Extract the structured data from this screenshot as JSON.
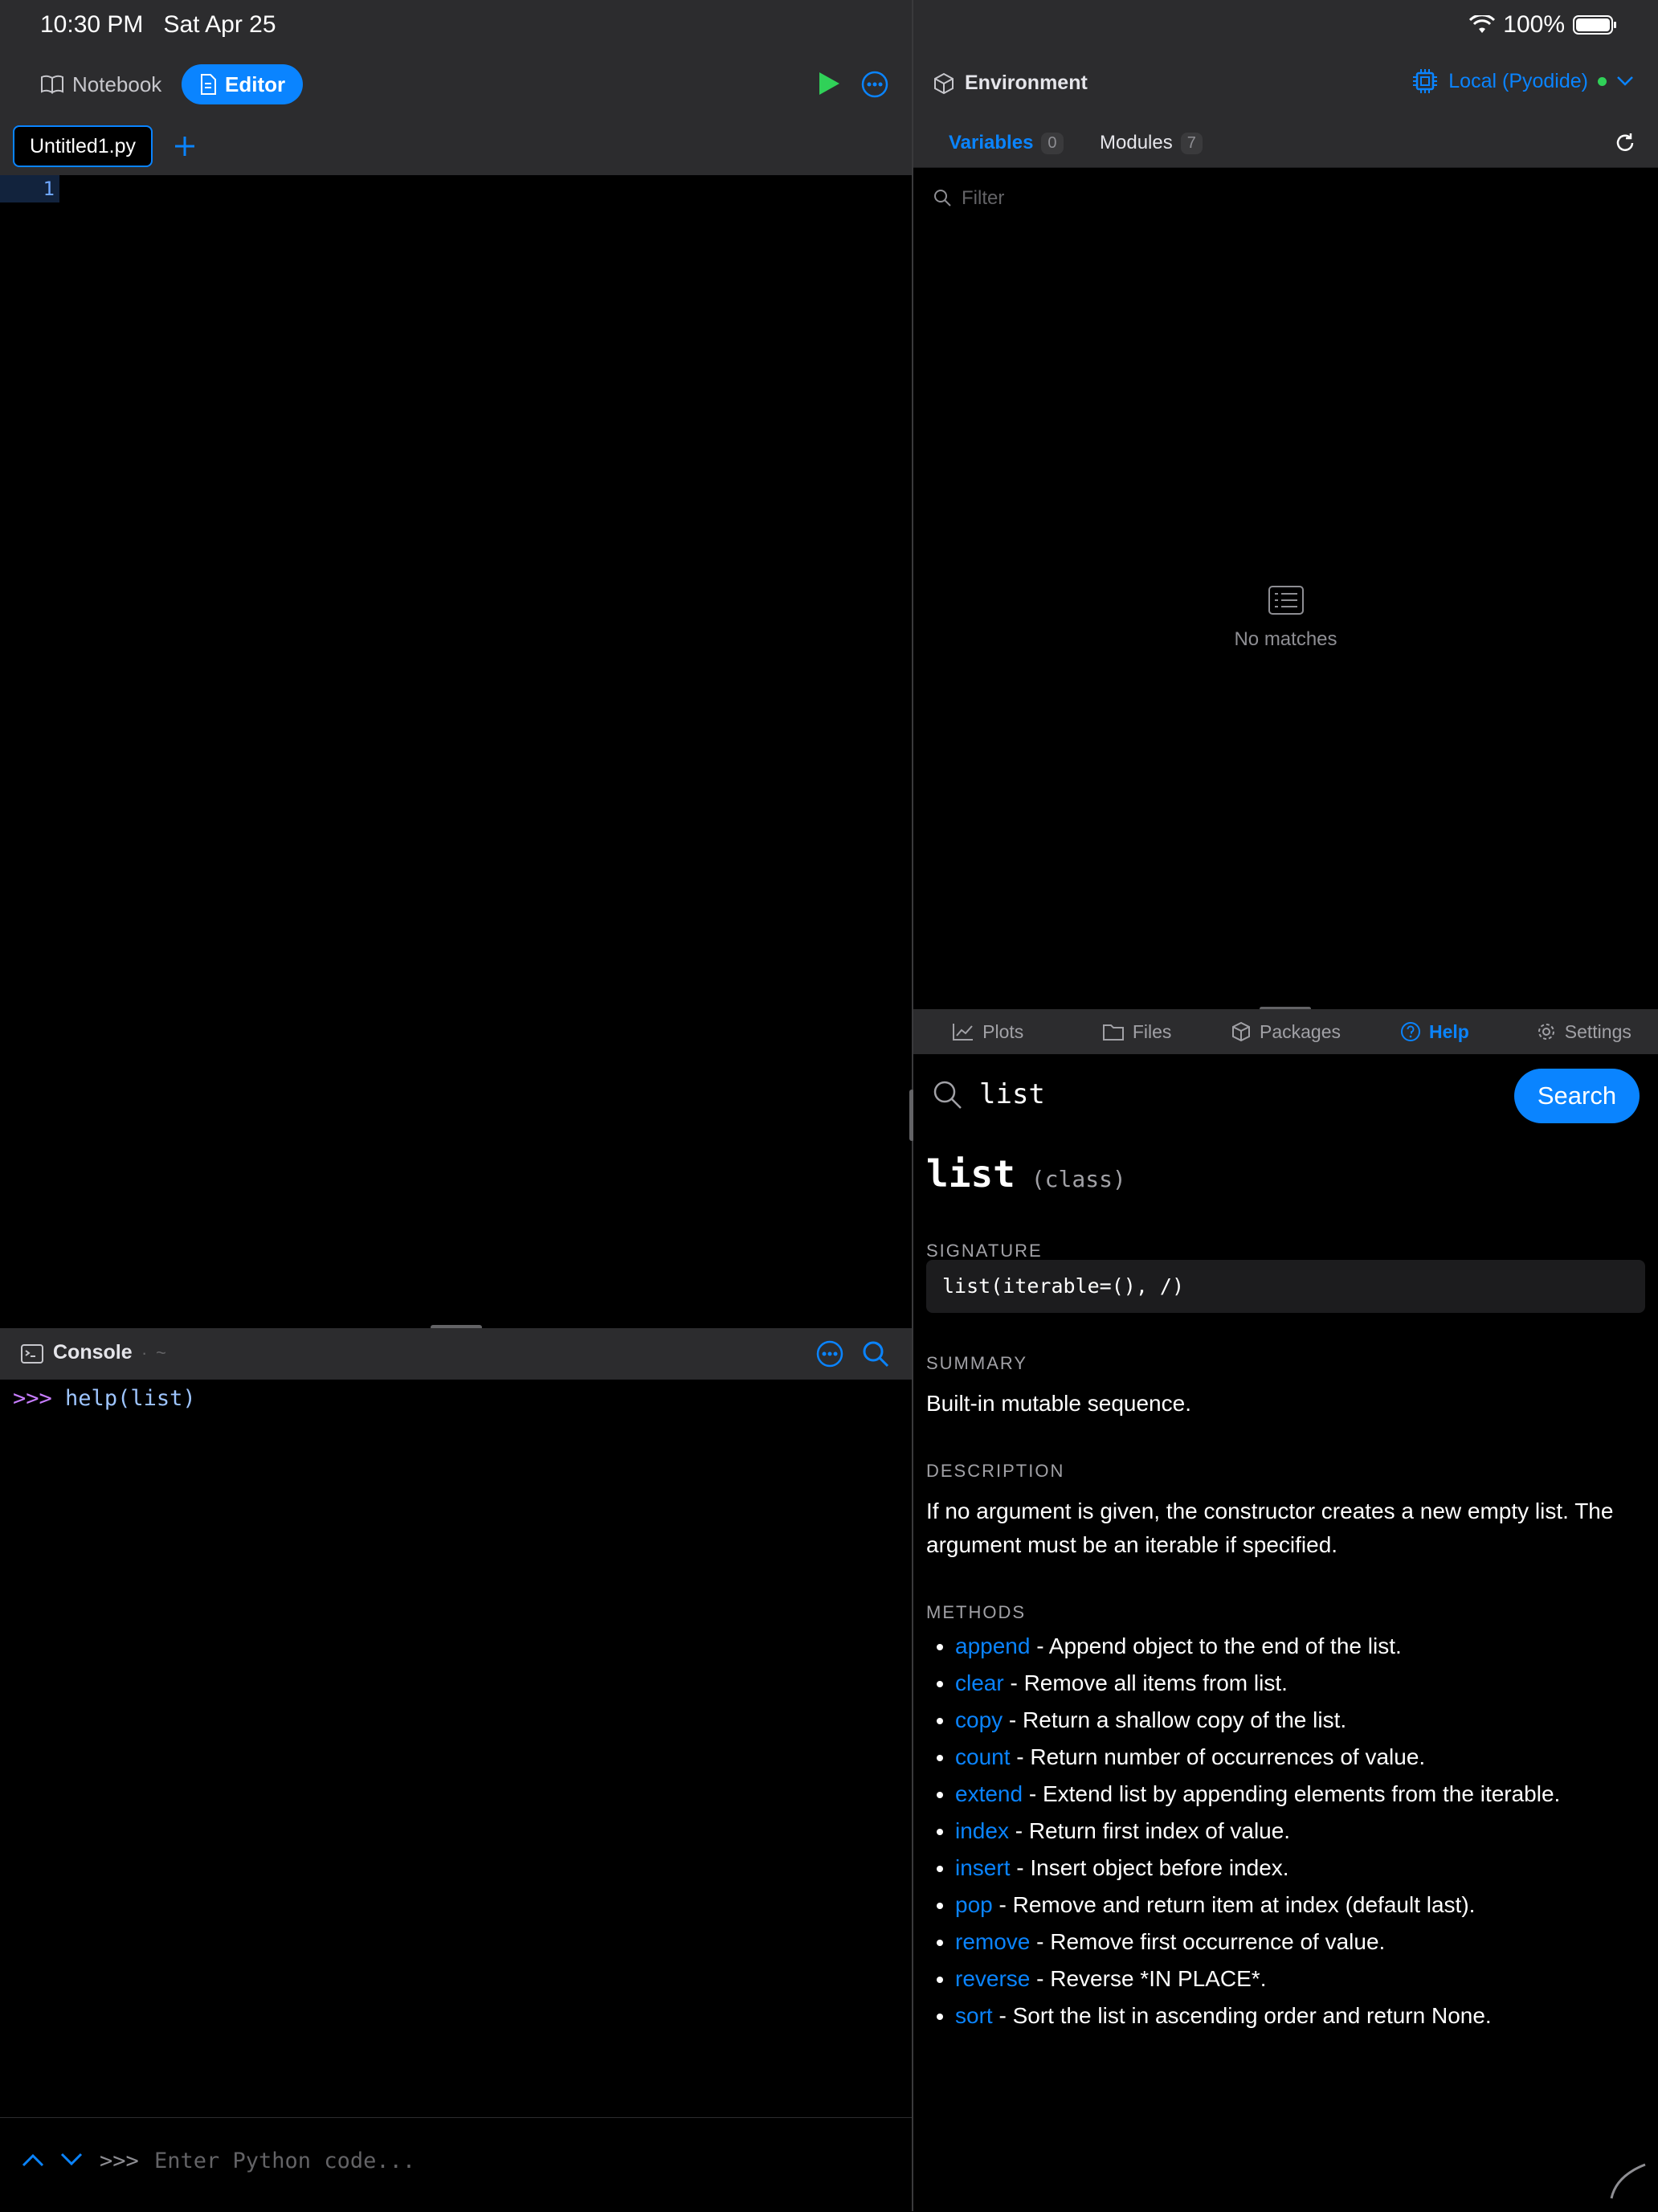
{
  "status_bar": {
    "time": "10:30 PM",
    "date": "Sat Apr 25",
    "battery": "100%"
  },
  "left_toolbar": {
    "notebook_label": "Notebook",
    "editor_label": "Editor"
  },
  "editor": {
    "file_tab": "Untitled1.py",
    "line_number": "1"
  },
  "console": {
    "title": "Console",
    "path": "~",
    "prompt": ">>>",
    "command": "help(list)",
    "input_prompt": ">>>",
    "input_placeholder": "Enter Python code..."
  },
  "environment": {
    "title": "Environment",
    "runtime": "Local (Pyodide)",
    "tabs": [
      {
        "label": "Variables",
        "count": "0"
      },
      {
        "label": "Modules",
        "count": "7"
      }
    ],
    "filter_placeholder": "Filter",
    "empty_text": "No matches"
  },
  "bottom_tabs": [
    {
      "label": "Plots",
      "icon": "chart-icon"
    },
    {
      "label": "Files",
      "icon": "folder-icon"
    },
    {
      "label": "Packages",
      "icon": "package-icon"
    },
    {
      "label": "Help",
      "icon": "question-icon"
    },
    {
      "label": "Settings",
      "icon": "gear-icon"
    }
  ],
  "help": {
    "query": "list",
    "search_label": "Search",
    "name": "list",
    "kind": "(class)",
    "signature_heading": "SIGNATURE",
    "signature": "list(iterable=(), /)",
    "summary_heading": "SUMMARY",
    "summary": "Built-in mutable sequence.",
    "description_heading": "DESCRIPTION",
    "description": "If no argument is given, the constructor creates a new empty list. The argument must be an iterable if specified.",
    "methods_heading": "METHODS",
    "methods": [
      {
        "name": "append",
        "desc": " - Append object to the end of the list."
      },
      {
        "name": "clear",
        "desc": " - Remove all items from list."
      },
      {
        "name": "copy",
        "desc": " - Return a shallow copy of the list."
      },
      {
        "name": "count",
        "desc": " - Return number of occurrences of value."
      },
      {
        "name": "extend",
        "desc": " - Extend list by appending elements from the iterable."
      },
      {
        "name": "index",
        "desc": " - Return first index of value."
      },
      {
        "name": "insert",
        "desc": " - Insert object before index."
      },
      {
        "name": "pop",
        "desc": " - Remove and return item at index (default last)."
      },
      {
        "name": "remove",
        "desc": " - Remove first occurrence of value."
      },
      {
        "name": "reverse",
        "desc": " - Reverse *IN PLACE*."
      },
      {
        "name": "sort",
        "desc": " - Sort the list in ascending order and return None."
      }
    ]
  },
  "colors": {
    "accent": "#0a84ff",
    "run": "#30d158",
    "status_dot": "#30d158",
    "prompt": "#c77dff"
  }
}
